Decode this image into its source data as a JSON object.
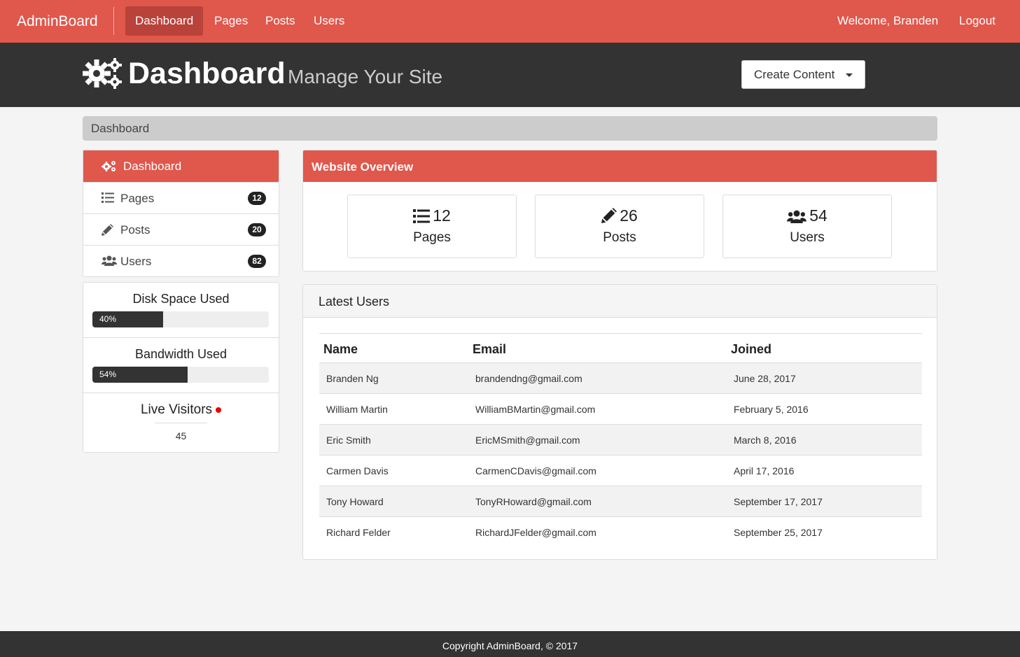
{
  "navbar": {
    "brand": "AdminBoard",
    "items": [
      {
        "label": "Dashboard",
        "active": true
      },
      {
        "label": "Pages",
        "active": false
      },
      {
        "label": "Posts",
        "active": false
      },
      {
        "label": "Users",
        "active": false
      }
    ],
    "welcome": "Welcome, Branden",
    "logout": "Logout"
  },
  "header": {
    "title": "Dashboard",
    "subtitle": "Manage Your Site",
    "create_button": "Create Content"
  },
  "breadcrumb": "Dashboard",
  "sidebar": {
    "items": [
      {
        "label": "Dashboard",
        "icon": "gears-icon",
        "active": true
      },
      {
        "label": "Pages",
        "icon": "list-icon",
        "badge": "12"
      },
      {
        "label": "Posts",
        "icon": "pencil-icon",
        "badge": "20"
      },
      {
        "label": "Users",
        "icon": "users-icon",
        "badge": "82"
      }
    ]
  },
  "stats": {
    "disk": {
      "title": "Disk Space Used",
      "percent": 40,
      "label": "40%"
    },
    "bandwidth": {
      "title": "Bandwidth Used",
      "percent": 54,
      "label": "54%"
    },
    "live": {
      "title": "Live Visitors",
      "count": "45"
    }
  },
  "overview": {
    "title": "Website Overview",
    "boxes": [
      {
        "value": "12",
        "label": "Pages",
        "icon": "list-icon"
      },
      {
        "value": "26",
        "label": "Posts",
        "icon": "pencil-icon"
      },
      {
        "value": "54",
        "label": "Users",
        "icon": "users-icon"
      }
    ]
  },
  "latest_users": {
    "title": "Latest Users",
    "columns": [
      "Name",
      "Email",
      "Joined"
    ],
    "rows": [
      {
        "name": "Branden Ng",
        "email": "brandendng@gmail.com",
        "joined": "June 28, 2017"
      },
      {
        "name": "William Martin",
        "email": "WilliamBMartin@gmail.com",
        "joined": "February 5, 2016"
      },
      {
        "name": "Eric Smith",
        "email": "EricMSmith@gmail.com",
        "joined": "March 8, 2016"
      },
      {
        "name": "Carmen Davis",
        "email": "CarmenCDavis@gmail.com",
        "joined": "April 17, 2016"
      },
      {
        "name": "Tony Howard",
        "email": "TonyRHoward@gmail.com",
        "joined": "September 17, 2017"
      },
      {
        "name": "Richard Felder",
        "email": "RichardJFelder@gmail.com",
        "joined": "September 25, 2017"
      }
    ]
  },
  "footer": "Copyright AdminBoard, © 2017",
  "colors": {
    "accent": "#e0574c",
    "accent_dark": "#b9423a",
    "header_bg": "#333333",
    "live_dot": "#e00000"
  }
}
